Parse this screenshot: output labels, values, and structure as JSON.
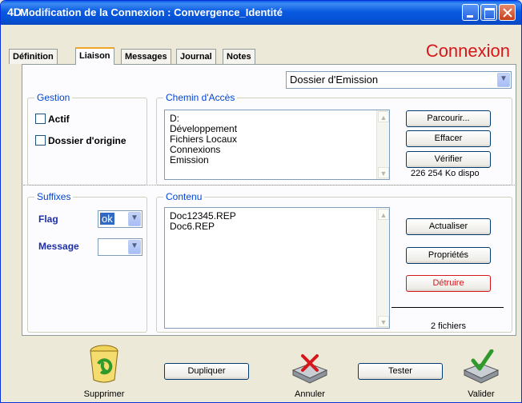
{
  "window": {
    "app_icon_glyph": "4D",
    "title": "Modification de la Connexion : Convergence_Identité",
    "heading": "Connexion"
  },
  "tabs": [
    {
      "label": "Définition"
    },
    {
      "label": "Liaison"
    },
    {
      "label": "Messages"
    },
    {
      "label": "Journal"
    },
    {
      "label": "Notes"
    }
  ],
  "dossier_select": {
    "value": "Dossier d'Emission"
  },
  "gestion": {
    "legend": "Gestion",
    "actif_label": "Actif",
    "dossier_origine_label": "Dossier d'origine"
  },
  "chemin": {
    "legend": "Chemin d'Accès",
    "lines": [
      "D:",
      "Développement",
      "Fichiers Locaux",
      "Connexions",
      "Emission"
    ],
    "parcourir_label": "Parcourir...",
    "effacer_label": "Effacer",
    "verifier_label": "Vérifier",
    "dispo": "226 254 Ko dispo"
  },
  "suffixes": {
    "legend": "Suffixes",
    "flag_label": "Flag",
    "flag_value": "ok",
    "message_label": "Message",
    "message_value": ""
  },
  "contenu": {
    "legend": "Contenu",
    "files": [
      "Doc12345.REP",
      "Doc6.REP"
    ],
    "actualiser_label": "Actualiser",
    "proprietes_label": "Propriétés",
    "detruire_label": "Détruire",
    "count": "2 fichiers"
  },
  "footer": {
    "supprimer_label": "Supprimer",
    "dupliquer_label": "Dupliquer",
    "annuler_label": "Annuler",
    "tester_label": "Tester",
    "valider_label": "Valider"
  },
  "colors": {
    "title_bar": "#0a5ae0",
    "heading_red": "#d6171b",
    "group_legend": "#0046d5",
    "field_label": "#1d2fa8"
  }
}
